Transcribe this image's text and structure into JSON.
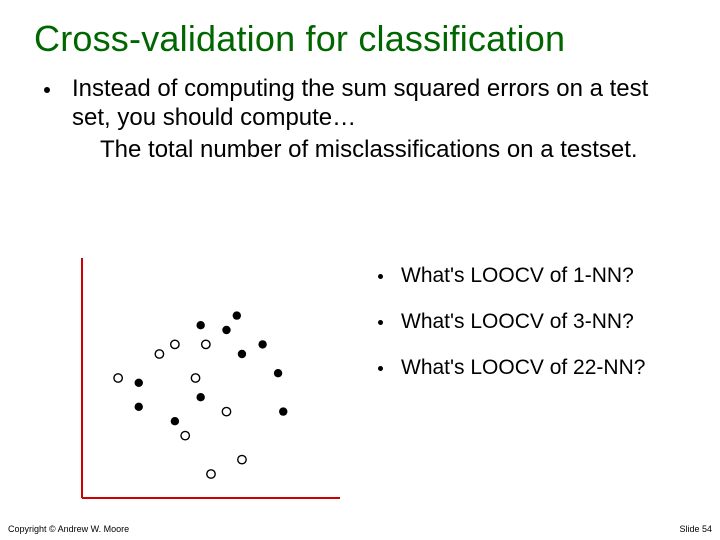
{
  "title": "Cross-validation for classification",
  "bullet1": "Instead of computing the sum squared errors on a test set, you should compute…",
  "bullet1_sub": "The total number of misclassifications on a testset.",
  "questions": [
    "What's LOOCV of 1-NN?",
    "What's LOOCV of 3-NN?",
    "What's LOOCV of 22-NN?"
  ],
  "copyright": "Copyright © Andrew W. Moore",
  "slide_label": "Slide 54",
  "chart_data": {
    "type": "scatter",
    "title": "",
    "xlabel": "",
    "ylabel": "",
    "xlim": [
      0,
      100
    ],
    "ylim": [
      0,
      100
    ],
    "series": [
      {
        "name": "class-a-filled",
        "marker": "filled-circle",
        "points": [
          {
            "x": 22,
            "y": 48
          },
          {
            "x": 22,
            "y": 38
          },
          {
            "x": 36,
            "y": 32
          },
          {
            "x": 46,
            "y": 42
          },
          {
            "x": 46,
            "y": 72
          },
          {
            "x": 56,
            "y": 70
          },
          {
            "x": 60,
            "y": 76
          },
          {
            "x": 62,
            "y": 60
          },
          {
            "x": 70,
            "y": 64
          },
          {
            "x": 76,
            "y": 52
          },
          {
            "x": 78,
            "y": 36
          }
        ]
      },
      {
        "name": "class-b-hollow",
        "marker": "hollow-circle",
        "points": [
          {
            "x": 14,
            "y": 50
          },
          {
            "x": 30,
            "y": 60
          },
          {
            "x": 36,
            "y": 64
          },
          {
            "x": 44,
            "y": 50
          },
          {
            "x": 40,
            "y": 26
          },
          {
            "x": 48,
            "y": 64
          },
          {
            "x": 50,
            "y": 10
          },
          {
            "x": 56,
            "y": 36
          },
          {
            "x": 62,
            "y": 16
          }
        ]
      }
    ]
  }
}
